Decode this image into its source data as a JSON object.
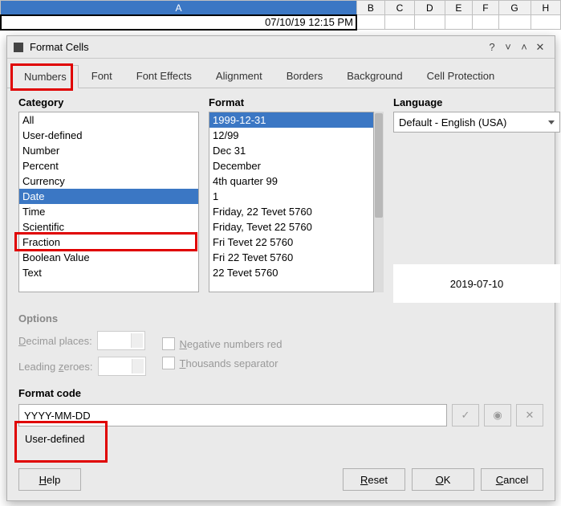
{
  "sheet": {
    "cols": [
      "A",
      "B",
      "C",
      "D",
      "E",
      "F",
      "G",
      "H"
    ],
    "cellA1": "07/10/19 12:15 PM"
  },
  "dialog": {
    "title": "Format Cells",
    "tabs": [
      "Numbers",
      "Font",
      "Font Effects",
      "Alignment",
      "Borders",
      "Background",
      "Cell Protection"
    ],
    "category_label": "Category",
    "categories": [
      "All",
      "User-defined",
      "Number",
      "Percent",
      "Currency",
      "Date",
      "Time",
      "Scientific",
      "Fraction",
      "Boolean Value",
      "Text"
    ],
    "category_selected": "Date",
    "format_label": "Format",
    "formats": [
      "1999-12-31",
      "12/99",
      "Dec 31",
      "December",
      "4th quarter 99",
      "1",
      "Friday, 22 Tevet 5760",
      "Friday, Tevet 22 5760",
      "Fri Tevet 22 5760",
      "Fri 22 Tevet 5760",
      "22 Tevet 5760"
    ],
    "format_selected": "1999-12-31",
    "language_label": "Language",
    "language_value": "Default - English (USA)",
    "preview": "2019-07-10",
    "options": {
      "heading": "Options",
      "decimal_label": "Decimal places:",
      "leading_label": "Leading zeroes:",
      "negred_label": "Negative numbers red",
      "thou_label": "Thousands separator"
    },
    "formatcode": {
      "heading": "Format code",
      "value": "YYYY-MM-DD",
      "userdef": "User-defined"
    },
    "buttons": {
      "help": "Help",
      "reset": "Reset",
      "ok": "OK",
      "cancel": "Cancel"
    }
  }
}
